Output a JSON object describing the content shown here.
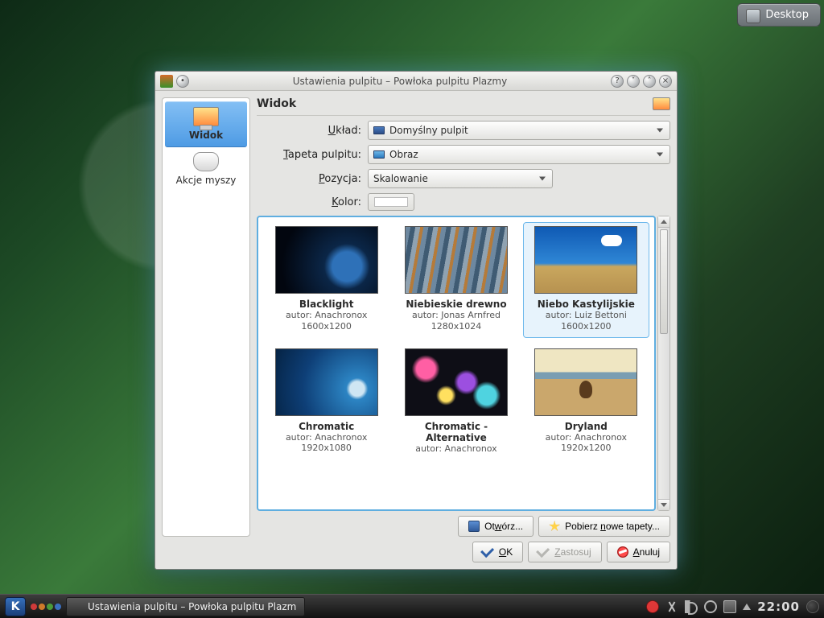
{
  "desktop_widget": {
    "label": "Desktop"
  },
  "window": {
    "title": "Ustawienia pulpitu – Powłoka pulpitu Plazmy",
    "sidebar": {
      "items": [
        {
          "label": "Widok",
          "active": true
        },
        {
          "label": "Akcje myszy",
          "active": false
        }
      ]
    },
    "heading": "Widok",
    "form": {
      "layout_label": "Układ:",
      "layout_value": "Domyślny pulpit",
      "wallpaper_label": "Tapeta pulpitu:",
      "wallpaper_value": "Obraz",
      "position_label": "Pozycja:",
      "position_value": "Skalowanie",
      "color_label": "Kolor:"
    },
    "wallpapers": [
      {
        "title": "Blacklight",
        "author": "autor: Anachronox",
        "res": "1600x1200",
        "cls": "blacklight",
        "selected": false
      },
      {
        "title": "Niebieskie drewno",
        "author": "autor: Jonas Arnfred",
        "res": "1280x1024",
        "cls": "bluewood",
        "selected": false
      },
      {
        "title": "Niebo Kastylijskie",
        "author": "autor: Luiz Bettoni",
        "res": "1600x1200",
        "cls": "sky",
        "selected": true
      },
      {
        "title": "Chromatic",
        "author": "autor: Anachronox",
        "res": "1920x1080",
        "cls": "chrom",
        "selected": false
      },
      {
        "title": "Chromatic - Alternative",
        "author": "autor: Anachronox",
        "res": "",
        "cls": "chromalt",
        "selected": false
      },
      {
        "title": "Dryland",
        "author": "autor: Anachronox",
        "res": "1920x1200",
        "cls": "dryland",
        "selected": false
      }
    ],
    "buttons": {
      "open": "Otwórz...",
      "get": "Pobierz nowe tapety...",
      "ok": "OK",
      "apply": "Zastosuj",
      "cancel": "Anuluj"
    }
  },
  "taskbar": {
    "task_title": "Ustawienia pulpitu – Powłoka pulpitu Plazm",
    "clock": "22:00"
  }
}
